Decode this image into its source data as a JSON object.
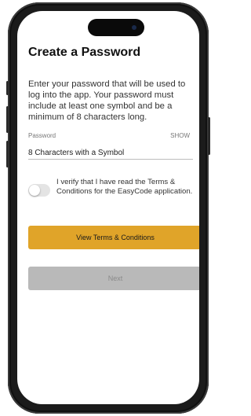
{
  "screen": {
    "title": "Create a Password",
    "description": "Enter your password that will be used to log into the app.  Your password must include at least one symbol and be a minimum of 8 characters long.",
    "password_field": {
      "label": "Password",
      "show_label": "SHOW",
      "placeholder": "8 Characters with a Symbol",
      "value": ""
    },
    "verify": {
      "text": "I verify that I have read the Terms & Conditions for the EasyCode application.",
      "toggle_on": false
    },
    "terms_button_label": "View Terms & Conditions",
    "next_button_label": "Next"
  },
  "colors": {
    "accent": "#e0a429",
    "disabled_button": "#b9b9b9",
    "disabled_text": "#8a8a8a"
  }
}
